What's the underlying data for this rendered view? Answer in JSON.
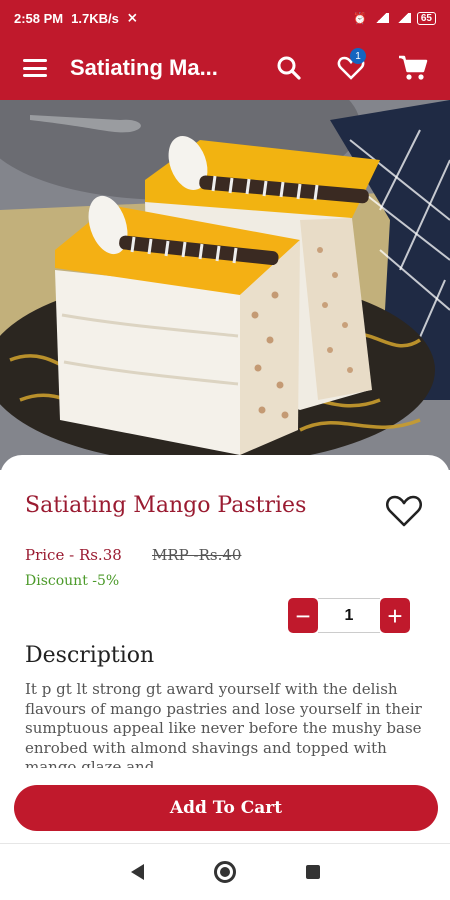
{
  "status_bar": {
    "time": "2:58 PM",
    "speed": "1.7KB/s",
    "battery": "65"
  },
  "app_bar": {
    "title": "Satiating Ma...",
    "wishlist_badge": "1"
  },
  "product": {
    "name": "Satiating Mango Pastries",
    "price": "Price - Rs.38",
    "mrp": "MRP -Rs.40",
    "discount": "Discount -5%",
    "quantity": "1",
    "description_heading": "Description",
    "description": "It p gt lt strong gt award yourself with the delish flavours of mango pastries and lose yourself in their sumptuous appeal like never before the mushy base enrobed with almond shavings and topped with mango glaze and"
  },
  "actions": {
    "add_to_cart": "Add To Cart",
    "decrement": "−",
    "increment": "+"
  },
  "colors": {
    "brand": "#c0192c",
    "title": "#9a1b31",
    "discount": "#4c9a2a"
  }
}
